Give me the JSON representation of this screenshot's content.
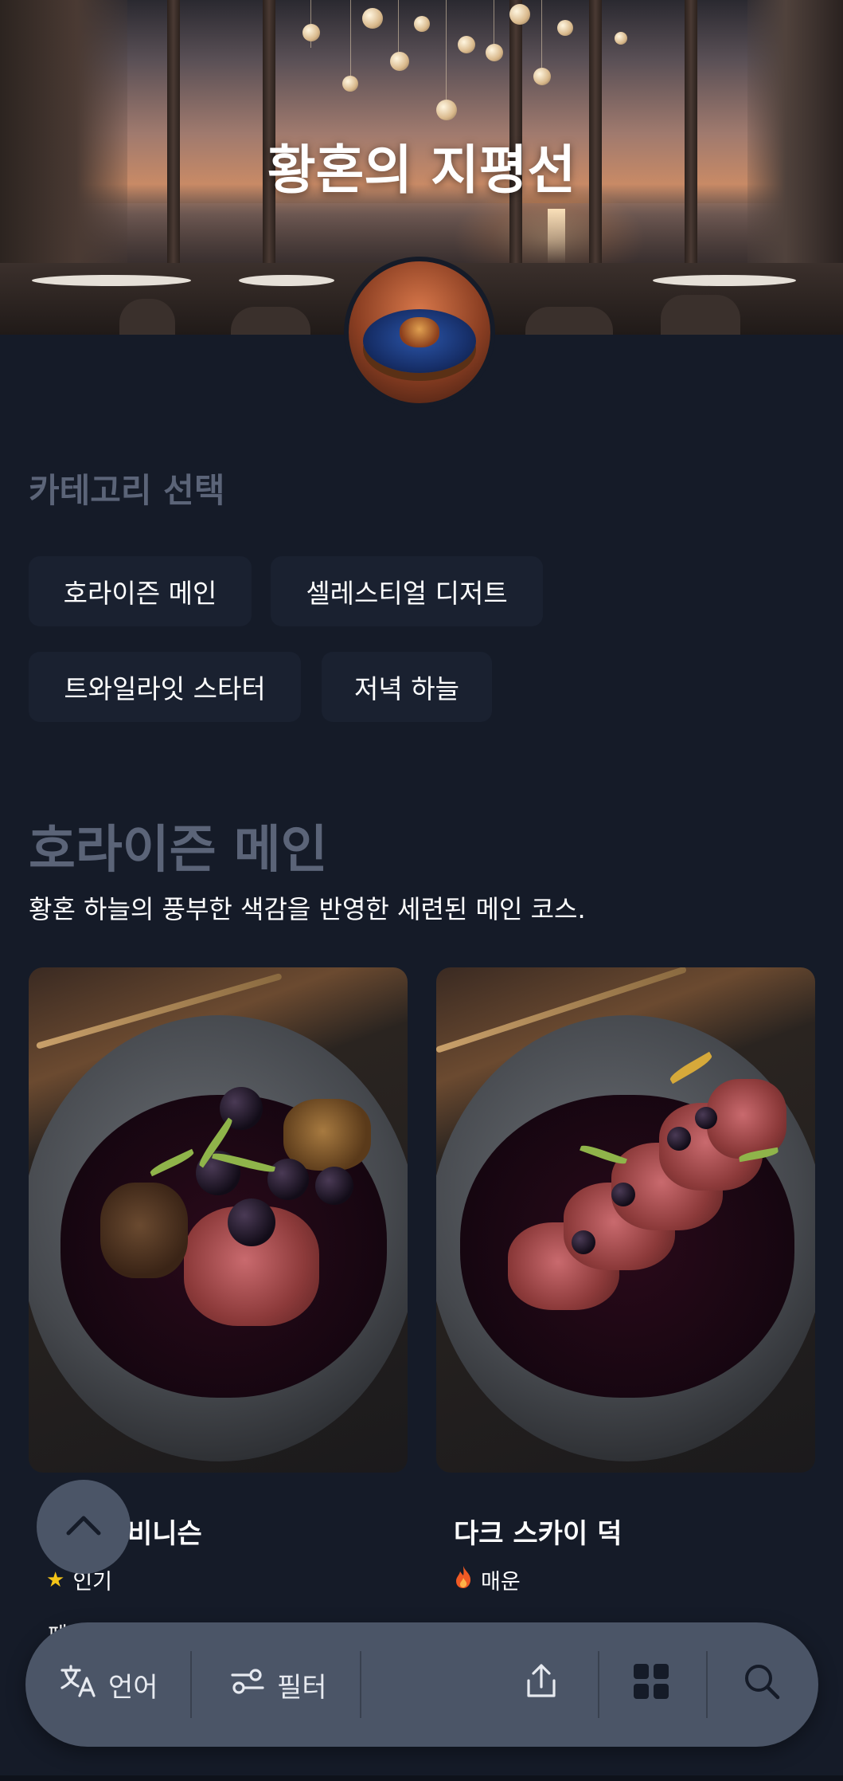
{
  "hero": {
    "title": "황혼의 지평선",
    "image_icon": "restaurant-sunset-photo"
  },
  "avatar": {
    "icon": "dish-photo"
  },
  "categories": {
    "heading": "카테고리 선택",
    "items": [
      {
        "label": "호라이즌 메인"
      },
      {
        "label": "셀레스티얼 디저트"
      },
      {
        "label": "트와일라잇 스타터"
      },
      {
        "label": "저녁 하늘"
      }
    ]
  },
  "section": {
    "title": "호라이즌 메인",
    "description": "황혼 하늘의 풍부한 색감을 반영한 세련된 메인 코스."
  },
  "menu_items": [
    {
      "name": "비니슨",
      "tag": "인기",
      "tag_icon": "star-icon",
      "tag_color": "#f5c518",
      "peek": "페"
    },
    {
      "name": "다크 스카이 덕",
      "tag": "매운",
      "tag_icon": "fire-icon",
      "tag_color": "#f05a24",
      "peek": ""
    }
  ],
  "toolbar": {
    "language_label": "언어",
    "filter_label": "필터",
    "icons": [
      "translate-icon",
      "filter-icon",
      "share-icon",
      "grid-icon",
      "search-icon"
    ]
  },
  "colors": {
    "background": "#151b28",
    "chip_bg": "#1a2130",
    "muted_heading": "#5b6478",
    "toolbar_bg": "#4b5567"
  }
}
